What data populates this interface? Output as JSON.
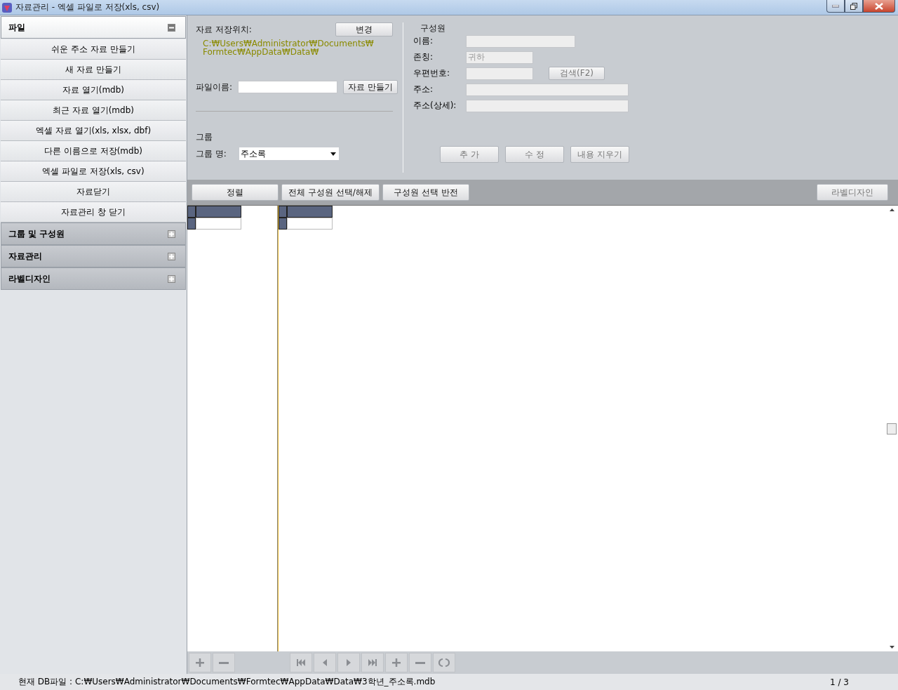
{
  "window": {
    "title": "자료관리 - 엑셀 파일로 저장(xls, csv)"
  },
  "sidebar": {
    "sections": [
      {
        "title": "파일",
        "expanded": true,
        "items": [
          "쉬운 주소 자료 만들기",
          "새 자료 만들기",
          "자료 열기(mdb)",
          "최근 자료 열기(mdb)",
          "엑셀 자료 열기(xls, xlsx, dbf)",
          "다른 이름으로 저장(mdb)",
          "엑셀 파일로 저장(xls, csv)",
          "자료닫기",
          "자료관리 창 닫기"
        ]
      },
      {
        "title": "그룹 및 구성원",
        "expanded": false
      },
      {
        "title": "자료관리",
        "expanded": false
      },
      {
        "title": "라벨디자인",
        "expanded": false
      }
    ]
  },
  "storage": {
    "label": "자료 저장위치:",
    "change_button": "변경",
    "path_line_1": "C:₩Users₩Administrator₩Documents₩",
    "path_line_2": "Formtec₩AppData₩Data₩",
    "filename_label": "파일이름:",
    "create_button": "자료 만들기"
  },
  "group": {
    "title": "그룹",
    "name_label": "그룹 명:",
    "name_value": "주소록"
  },
  "member": {
    "title": "구성원",
    "fields": [
      {
        "label": "이름:"
      },
      {
        "label": "존칭:",
        "value": "귀하"
      },
      {
        "label": "우편번호:"
      },
      {
        "label": "주소:"
      },
      {
        "label": "주소(상세):"
      }
    ],
    "search_button": {
      "label": "검색(F2)",
      "disabled": true
    },
    "buttons": [
      {
        "label": "추 가",
        "disabled": true
      },
      {
        "label": "수 정",
        "disabled": true
      },
      {
        "label": "내용 지우기",
        "disabled": true
      }
    ]
  },
  "toolbar": {
    "buttons": [
      {
        "label": "정렬",
        "disabled": false
      },
      {
        "label": "전체 구성원 선택/해제",
        "disabled": false
      },
      {
        "label": "구성원 선택 반전",
        "disabled": false
      }
    ],
    "right_button": {
      "label": "라벨디자인",
      "disabled": true
    }
  },
  "status_bar": {
    "path": "현재 DB파일 : C:₩Users₩Administrator₩Documents₩Formtec₩AppData₩Data₩3학년_주소록.mdb",
    "page": "1 / 3"
  }
}
